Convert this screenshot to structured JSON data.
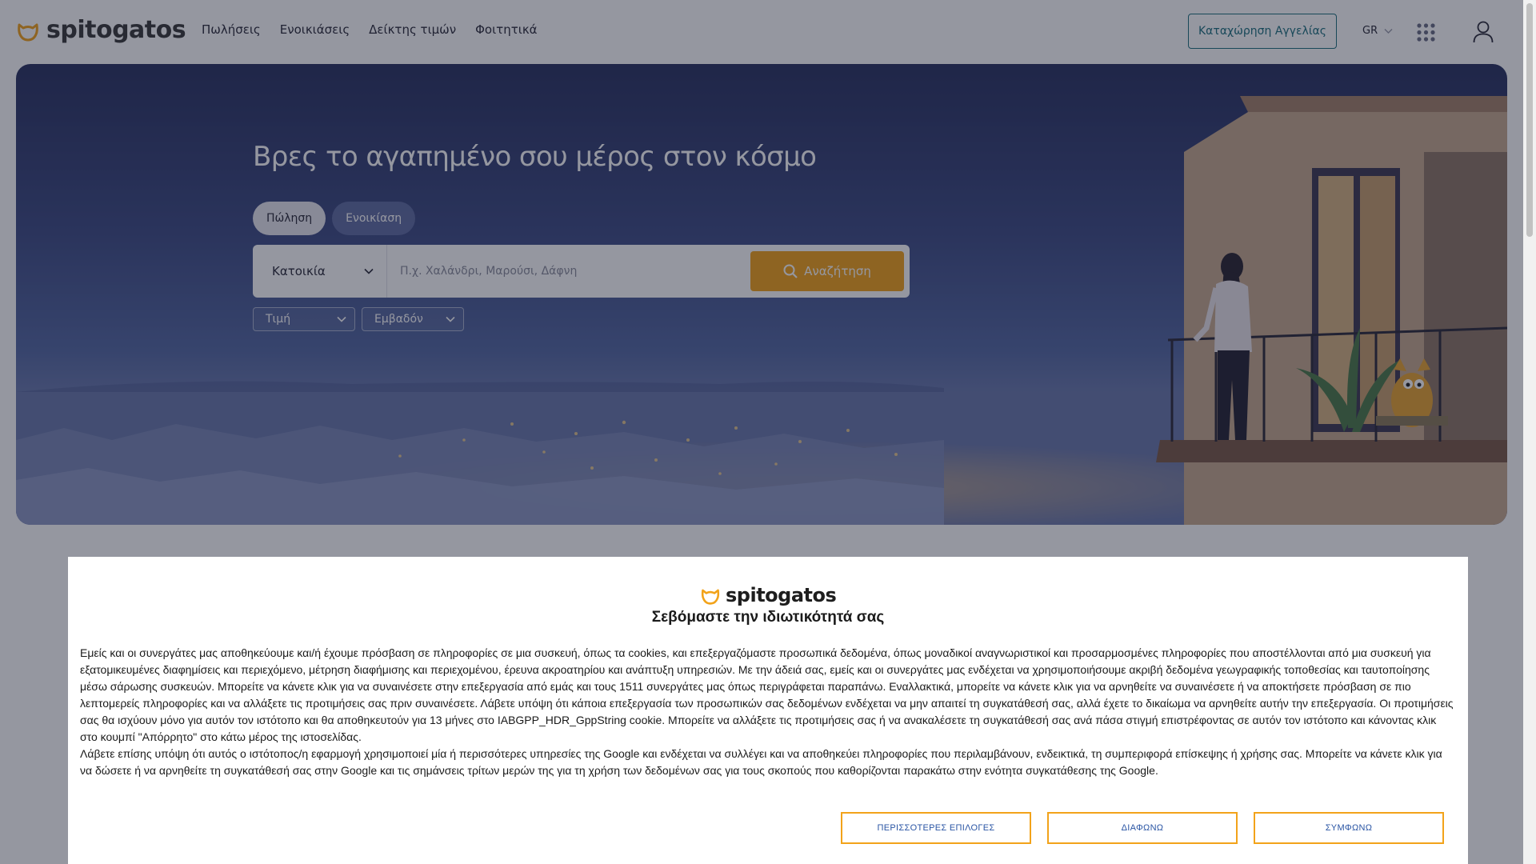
{
  "header": {
    "logo_text": "spitogatos",
    "nav": [
      "Πωλήσεις",
      "Ενοικιάσεις",
      "Δείκτης τιμών",
      "Φοιτητικά"
    ],
    "list_button": "Καταχώρηση Αγγελίας",
    "language": "GR",
    "icons": [
      "cat-logo-icon",
      "apps-grid-icon",
      "user-icon",
      "chevron-down-icon"
    ]
  },
  "hero": {
    "title": "Βρες το αγαπημένο σου μέρος στον κόσμο",
    "tabs": [
      {
        "label": "Πώληση",
        "active": true
      },
      {
        "label": "Ενοικίαση",
        "active": false
      }
    ],
    "property_type": "Κατοικία",
    "location_placeholder": "Π.χ. Χαλάνδρι, Μαρούσι, Δάφνη",
    "search_button": "Αναζήτηση",
    "filters": [
      "Τιμή",
      "Εμβαδόν"
    ]
  },
  "consent": {
    "logo_text": "spitogatos",
    "title": "Σεβόμαστε την ιδιωτικότητά σας",
    "paragraph1": "Εμείς και οι συνεργάτες μας αποθηκεύουμε και/ή έχουμε πρόσβαση σε πληροφορίες σε μια συσκευή, όπως τα cookies, και επεξεργαζόμαστε προσωπικά δεδομένα, όπως μοναδικοί αναγνωριστικοί και προσαρμοσμένες πληροφορίες που αποστέλλονται από μια συσκευή για εξατομικευμένες διαφημίσεις και περιεχόμενο, μέτρηση διαφήμισης και περιεχομένου, έρευνα ακροατηρίου και ανάπτυξη υπηρεσιών. Με την άδειά σας, εμείς και οι συνεργάτες μας ενδέχεται να χρησιμοποιήσουμε ακριβή δεδομένα γεωγραφικής τοποθεσίας και ταυτοποίησης μέσω σάρωσης συσκευών. Μπορείτε να κάνετε κλικ για να συναινέσετε στην επεξεργασία από εμάς και τους 1511 συνεργάτες μας όπως περιγράφεται παραπάνω. Εναλλακτικά, μπορείτε να κάνετε κλικ για να αρνηθείτε να συναινέσετε ή να αποκτήσετε πρόσβαση σε πιο λεπτομερείς πληροφορίες και να αλλάξετε τις προτιμήσεις σας πριν συναινέσετε. Λάβετε υπόψη ότι κάποια επεξεργασία των προσωπικών σας δεδομένων ενδέχεται να μην απαιτεί τη συγκατάθεσή σας, αλλά έχετε το δικαίωμα να αρνηθείτε αυτήν την επεξεργασία. Οι προτιμήσεις σας θα ισχύουν μόνο για αυτόν τον ιστότοπο και θα αποθηκευτούν για 13 μήνες στο IABGPP_HDR_GppString cookie. Μπορείτε να αλλάξετε τις προτιμήσεις σας ή να ανακαλέσετε τη συγκατάθεσή σας ανά πάσα στιγμή επιστρέφοντας σε αυτόν τον ιστότοπο και κάνοντας κλικ στο κουμπί \"Απόρρητο\" στο κάτω μέρος της ιστοσελίδας.",
    "paragraph2": "Λάβετε επίσης υπόψη ότι αυτός ο ιστότοπος/η εφαρμογή χρησιμοποιεί μία ή περισσότερες υπηρεσίες της Google και ενδέχεται να συλλέγει και να αποθηκεύει πληροφορίες που περιλαμβάνουν, ενδεικτικά, τη συμπεριφορά επίσκεψης ή χρήσης σας. Μπορείτε να κάνετε κλικ για να δώσετε ή να αρνηθείτε τη συγκατάθεσή σας στην Google και τις σημάνσεις τρίτων μερών της για τη χρήση των δεδομένων σας για τους σκοπούς που καθορίζονται παρακάτω στην ενότητα συγκατάθεσης της Google.",
    "buttons": {
      "more": "ΠΕΡΙΣΣΟΤΕΡΕΣ ΕΠΙΛΟΓΕΣ",
      "disagree": "ΔΙΑΦΩΝΩ",
      "agree": "ΣΥΜΦΩΝΩ"
    }
  },
  "colors": {
    "brand_orange": "#f2a31a",
    "brand_teal": "#1d6f7e",
    "consent_button_text": "#2a55a4"
  }
}
